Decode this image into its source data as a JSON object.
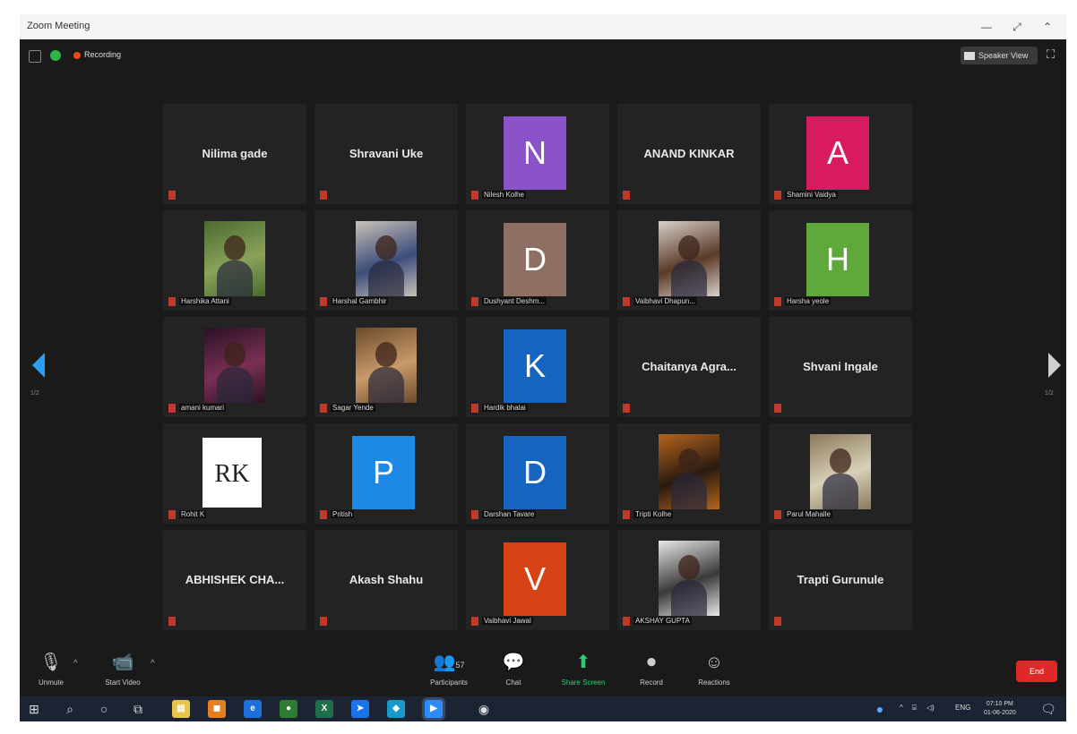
{
  "window": {
    "title": "Zoom Meeting",
    "minimize": "—",
    "restore": "⤢",
    "close": "⌃"
  },
  "topbar": {
    "recording_label": "Recording",
    "view_button": "Speaker View"
  },
  "paging": {
    "left_page": "1/2",
    "right_page": "1/2"
  },
  "participants": [
    {
      "name": "Nilima gade",
      "type": "text"
    },
    {
      "name": "Shravani Uke",
      "type": "text"
    },
    {
      "name": "Nilesh Kolhe",
      "type": "avatar",
      "letter": "N",
      "color": "#8b53c9"
    },
    {
      "name": "ANAND KINKAR",
      "type": "text"
    },
    {
      "name": "Shamini Vaidya",
      "type": "avatar",
      "letter": "A",
      "color": "#d81b60"
    },
    {
      "name": "Harshika Attani",
      "type": "photo",
      "palette": [
        "#4a6b2e",
        "#8aa25a"
      ]
    },
    {
      "name": "Harshal Gambhir",
      "type": "photo",
      "palette": [
        "#c9c2b8",
        "#3b4d7a"
      ]
    },
    {
      "name": "Dushyant Deshm...",
      "type": "avatar",
      "letter": "D",
      "color": "#8d7063"
    },
    {
      "name": "Vaibhavi Dhapun...",
      "type": "photo",
      "palette": [
        "#d8d0c8",
        "#5a3a28"
      ]
    },
    {
      "name": "Harsha yeole",
      "type": "avatar",
      "letter": "H",
      "color": "#5fa83b"
    },
    {
      "name": "amani kumari",
      "type": "photo",
      "palette": [
        "#2a1224",
        "#7a2f52"
      ]
    },
    {
      "name": "Sagar Yende",
      "type": "photo",
      "palette": [
        "#6b4a2a",
        "#c99a6a"
      ]
    },
    {
      "name": "Hardik bhalai",
      "type": "avatar",
      "letter": "K",
      "color": "#1565c0"
    },
    {
      "name": "Chaitanya Agra...",
      "type": "text"
    },
    {
      "name": "Shvani Ingale",
      "type": "text"
    },
    {
      "name": "Rohit K",
      "type": "logo",
      "letter": "RK"
    },
    {
      "name": "Pritish",
      "type": "avatar",
      "letter": "P",
      "color": "#1e88e5"
    },
    {
      "name": "Darshan Tavare",
      "type": "avatar",
      "letter": "D",
      "color": "#1565c0"
    },
    {
      "name": "Tripti Kolhe",
      "type": "photo",
      "palette": [
        "#b5651d",
        "#2a1a10"
      ]
    },
    {
      "name": "Parul Mahalle",
      "type": "photo",
      "palette": [
        "#8a7a5a",
        "#d8d0b8"
      ]
    },
    {
      "name": "ABHISHEK CHA...",
      "type": "text"
    },
    {
      "name": "Akash Shahu",
      "type": "text"
    },
    {
      "name": "Vaibhavi Jawal",
      "type": "avatar",
      "letter": "V",
      "color": "#d84315"
    },
    {
      "name": "AKSHAY GUPTA",
      "type": "photo",
      "palette": [
        "#e8e8e8",
        "#3a3a3a"
      ]
    },
    {
      "name": "Trapti Gurunule",
      "type": "text"
    }
  ],
  "controls": {
    "unmute": "Unmute",
    "start_video": "Start Video",
    "participants": "Participants",
    "participants_count": "57",
    "chat": "Chat",
    "share_screen": "Share Screen",
    "record": "Record",
    "reactions": "Reactions",
    "end": "End"
  },
  "taskbar": {
    "lang": "ENG",
    "time": "07:10 PM",
    "date": "01-06-2020"
  },
  "colors": {
    "share_green": "#2ecc71",
    "end_red": "#e02828",
    "muted_red": "#c0392b"
  }
}
